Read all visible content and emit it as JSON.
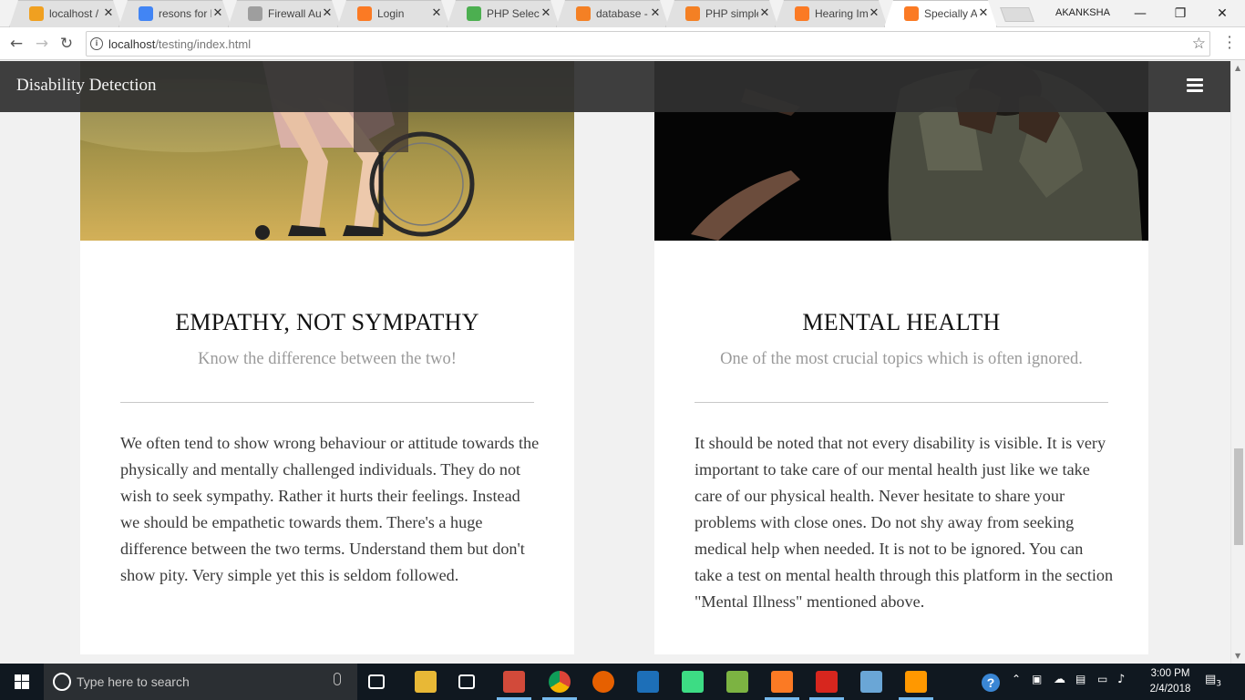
{
  "browser": {
    "tabs": [
      {
        "title": "localhost /",
        "favicon": "phpmyadmin-icon",
        "color": "#f0a020"
      },
      {
        "title": "resons for l",
        "favicon": "google-icon",
        "color": "#4285f4"
      },
      {
        "title": "Firewall Au",
        "favicon": "document-icon",
        "color": "#9e9e9e"
      },
      {
        "title": "Login",
        "favicon": "xampp-icon",
        "color": "#fb7a24"
      },
      {
        "title": "PHP Select",
        "favicon": "w3schools-icon",
        "color": "#4caf50"
      },
      {
        "title": "database -",
        "favicon": "stackoverflow-icon",
        "color": "#f48024"
      },
      {
        "title": "PHP simple",
        "favicon": "stackoverflow-icon",
        "color": "#f48024"
      },
      {
        "title": "Hearing Im",
        "favicon": "xampp-icon",
        "color": "#fb7a24"
      },
      {
        "title": "Specially A",
        "favicon": "xampp-icon",
        "color": "#fb7a24"
      }
    ],
    "tab_close_glyph": "✕",
    "profile_name": "AKANKSHA",
    "window_controls": {
      "minimize": "—",
      "restore": "❐",
      "close": "✕"
    },
    "nav": {
      "back": "←",
      "forward": "→",
      "reload": "↻"
    },
    "url_host": "localhost",
    "url_path": "/testing/index.html",
    "bookmark_glyph": "☆",
    "info_glyph": "i"
  },
  "site": {
    "brand": "Disability Detection",
    "cards": [
      {
        "title": "EMPATHY, NOT SYMPATHY",
        "subtitle": "Know the difference between the two!",
        "body": "We often tend to show wrong behaviour or attitude towards the physically and mentally challenged individuals. They do not wish to seek sympathy. Rather it hurts their feelings. Instead we should be empathetic towards them. There's a huge difference between the two terms. Understand them but don't show pity. Very simple yet this is seldom followed."
      },
      {
        "title": "MENTAL HEALTH",
        "subtitle": "One of the most crucial topics which is often ignored.",
        "body": "It should be noted that not every disability is visible. It is very important to take care of our mental health just like we take care of our physical health. Never hesitate to share your problems with close ones. Do not shy away from seeking medical help when needed. It is not to be ignored. You can take a test on mental health through this platform in the section \"Mental Illness\" mentioned above."
      }
    ]
  },
  "taskbar": {
    "search_placeholder": "Type here to search",
    "apps": [
      {
        "name": "task-view-icon",
        "color": "#101820",
        "label": ""
      },
      {
        "name": "file-explorer-icon",
        "color": "#e8b836",
        "label": ""
      },
      {
        "name": "store-icon",
        "color": "#101820",
        "label": ""
      },
      {
        "name": "flashcard-app-icon",
        "color": "#d24a3a",
        "label": ""
      },
      {
        "name": "chrome-icon",
        "color": "#2f9d49",
        "label": ""
      },
      {
        "name": "firefox-icon",
        "color": "#e66000",
        "label": ""
      },
      {
        "name": "eclipse-icon",
        "color": "#1d6fb8",
        "label": ""
      },
      {
        "name": "android-studio-icon",
        "color": "#3ddc84",
        "label": ""
      },
      {
        "name": "colorful-app-icon",
        "color": "#7cb342",
        "label": ""
      },
      {
        "name": "xampp-taskbar-icon",
        "color": "#fb7a24",
        "label": ""
      },
      {
        "name": "acrobat-icon",
        "color": "#d7261e",
        "label": ""
      },
      {
        "name": "notepad-icon",
        "color": "#6aa6d6",
        "label": ""
      },
      {
        "name": "sublime-icon",
        "color": "#ff9800",
        "label": ""
      }
    ],
    "time": "3:00 PM",
    "date": "2/4/2018",
    "notification_count": "3"
  }
}
